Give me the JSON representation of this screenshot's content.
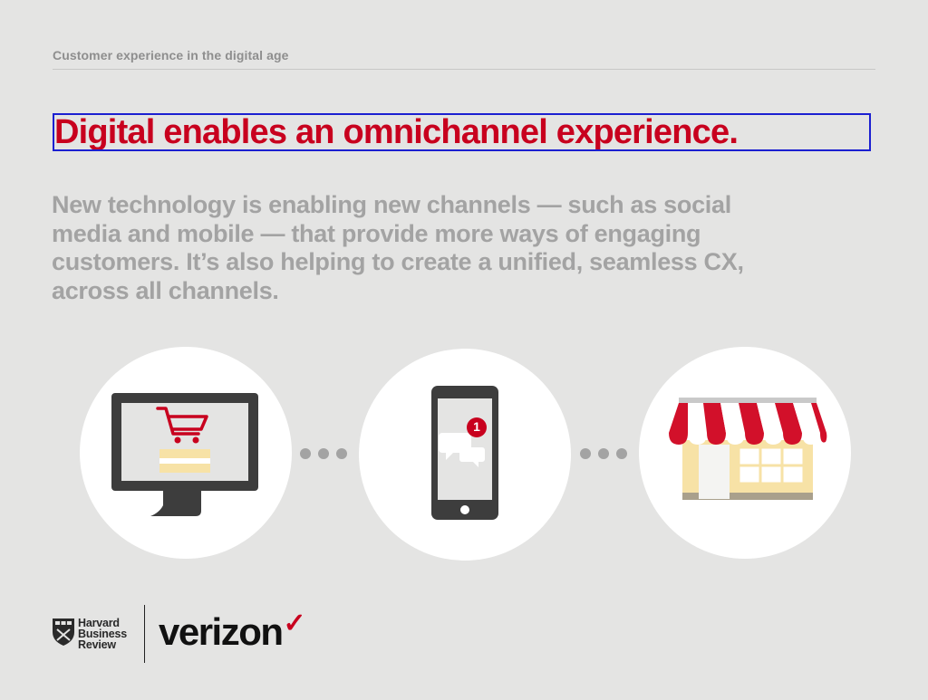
{
  "header": {
    "kicker": "Customer experience in the digital age"
  },
  "main": {
    "headline": "Digital enables an omnichannel experience.",
    "lede": "New technology is enabling new channels — such as social media and mobile — that provide more ways of engaging customers. It’s also helping to create a unified, seamless CX, across all channels."
  },
  "illustration": {
    "icons": [
      "desktop-shopping-cart-icon",
      "phone-chat-notification-icon",
      "storefront-awning-icon"
    ],
    "notification_count": "1",
    "colors": {
      "accent_red": "#c8001e",
      "dark_gray": "#3d3d3d",
      "dot_gray": "#a3a3a3",
      "cream": "#f7e2a6"
    }
  },
  "footer": {
    "hbr_line1": "Harvard",
    "hbr_line2": "Business",
    "hbr_line3": "Review",
    "brand": "verizon",
    "brand_check": "✓"
  }
}
